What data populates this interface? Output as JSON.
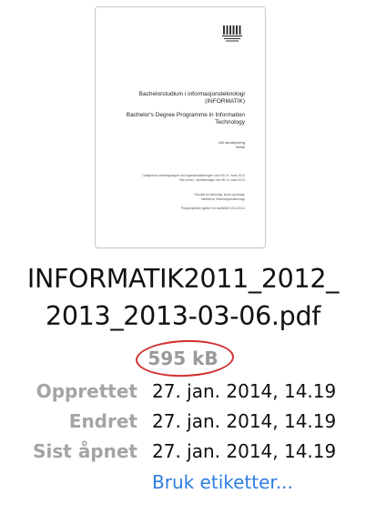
{
  "preview": {
    "title_line1": "Bachelorstudium i informasjonsteknologi",
    "title_line2": "(INFORMATIK)",
    "title_en_line1": "Bachelor's Degree Programme in Information",
    "title_en_line2": "Technology",
    "credits": "180 studiepoeng",
    "mode": "Heltid",
    "approval_line1": "Godkjent av Avdelingsstyret ved ingeniørutdanningen ved HiG 21. mars 2010",
    "approval_line2": "Sist endret - studieutvalget ved HiG 6. mars 2013",
    "faculty_line1": "Fakultet for teknologi, kunst og design",
    "faculty_line2": "Institutt for informasjonsteknologi",
    "plan_line": "Programplanen gjelder for studieåret 2013-2014"
  },
  "file": {
    "name_line1": "INFORMATIK2011_2012_",
    "name_line2": "2013_2013-03-06.pdf",
    "size": "595 kB"
  },
  "meta": {
    "created_label": "Opprettet",
    "created_value": "27. jan. 2014, 14.19",
    "modified_label": "Endret",
    "modified_value": "27. jan. 2014, 14.19",
    "opened_label": "Sist åpnet",
    "opened_value": "27. jan. 2014, 14.19"
  },
  "actions": {
    "tags_label": "Bruk etiketter..."
  },
  "colors": {
    "label_gray": "#a4a4a4",
    "size_gray": "#9a9a9a",
    "link_blue": "#2f7de1",
    "annotation_red": "#d0302f"
  }
}
